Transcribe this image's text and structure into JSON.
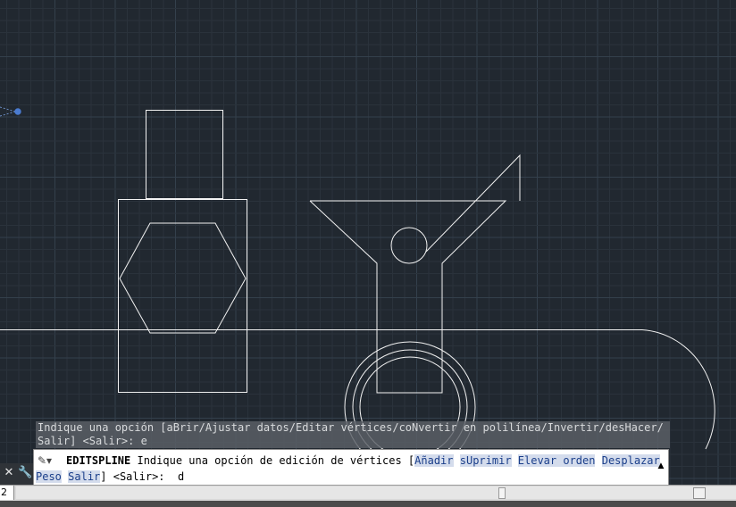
{
  "theme": {
    "background": "#212830",
    "grid_minor": "#2a323b",
    "grid_major": "#34404c",
    "geometry": "#f2f2f2",
    "grip": "#4a7bd0"
  },
  "history": {
    "line1": "Indique una opción [aBrir/Ajustar datos/Editar vértices/coNvertir en polilínea/Invertir/desHacer/",
    "line2": "Salir] <Salir>: e"
  },
  "command": {
    "icon": "pencil-icon",
    "name": "EDITSPLINE",
    "prompt": "Indique una opción de edición de vértices [",
    "options": [
      {
        "hotkey": "A",
        "label": "Añadir"
      },
      {
        "hotkey": "sU",
        "label": "sUprimir"
      },
      {
        "hotkey": "E",
        "label": "Elevar orden"
      },
      {
        "hotkey": "D",
        "label": "Desplazar"
      },
      {
        "hotkey": "P",
        "label": "Peso"
      },
      {
        "hotkey": "S",
        "label": "Salir"
      }
    ],
    "suffix": "] <Salir>:",
    "input_value": "d"
  },
  "status": {
    "layout_index": "2"
  },
  "toolbar": {
    "close_icon": "close-icon",
    "customize_icon": "wrench-icon"
  }
}
